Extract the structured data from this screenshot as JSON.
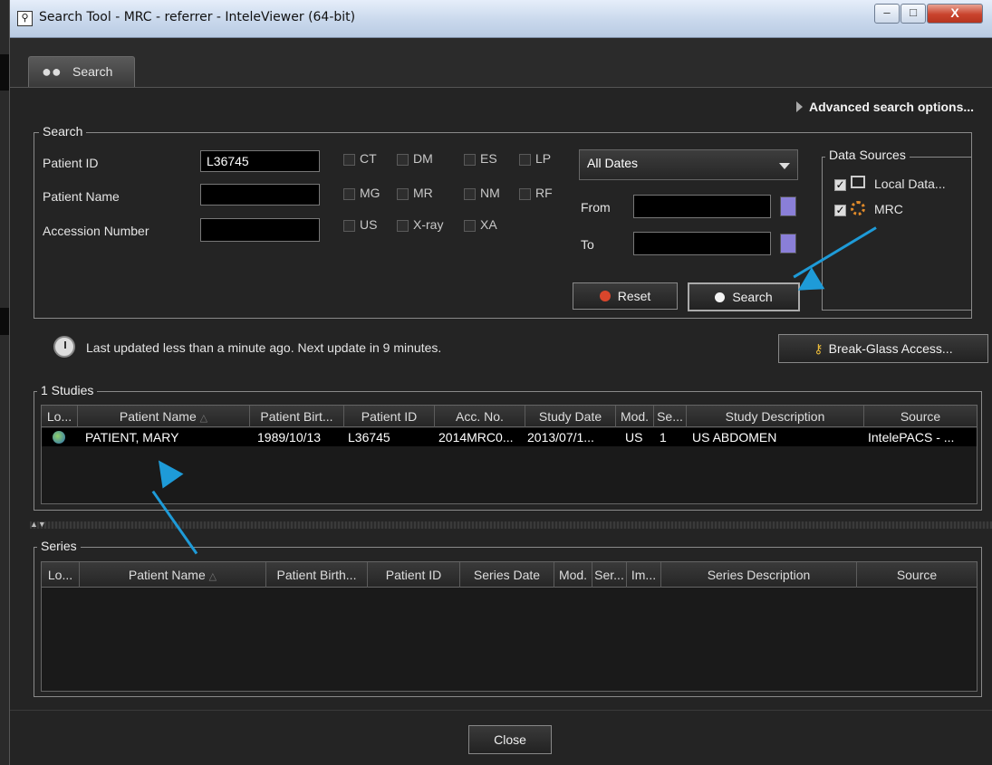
{
  "window": {
    "title": "Search Tool - MRC - referrer - InteleViewer (64-bit)",
    "min_label": "–",
    "max_label": "□",
    "close_label": "X"
  },
  "tab": {
    "label": "Search"
  },
  "advanced": {
    "label": "Advanced search options..."
  },
  "search": {
    "group_label": "Search",
    "patient_id_label": "Patient ID",
    "patient_id_value": "L36745",
    "patient_name_label": "Patient Name",
    "patient_name_value": "",
    "accession_label": "Accession Number",
    "accession_value": "",
    "modalities": [
      {
        "label": "CT",
        "checked": false
      },
      {
        "label": "DM",
        "checked": false
      },
      {
        "label": "ES",
        "checked": false
      },
      {
        "label": "LP",
        "checked": false
      },
      {
        "label": "MG",
        "checked": false
      },
      {
        "label": "MR",
        "checked": false
      },
      {
        "label": "NM",
        "checked": false
      },
      {
        "label": "RF",
        "checked": false
      },
      {
        "label": "US",
        "checked": false
      },
      {
        "label": "X-ray",
        "checked": false
      },
      {
        "label": "XA",
        "checked": false
      }
    ],
    "date_range": "All Dates",
    "from_label": "From",
    "to_label": "To",
    "from_value": "",
    "to_value": "",
    "reset_label": "Reset",
    "search_label": "Search"
  },
  "data_sources": {
    "label": "Data Sources",
    "items": [
      {
        "label": "Local Data...",
        "checked": true
      },
      {
        "label": "MRC",
        "checked": true
      }
    ]
  },
  "status": {
    "text": "Last updated less than a minute ago. Next update in 9 minutes.",
    "break_glass_label": "Break-Glass Access..."
  },
  "studies": {
    "group_label": "1 Studies",
    "columns": [
      "Lo...",
      "Patient Name",
      "Patient Birt...",
      "Patient ID",
      "Acc. No.",
      "Study Date",
      "Mod.",
      "Se...",
      "Study Description",
      "Source"
    ],
    "rows": [
      [
        "",
        "PATIENT, MARY",
        "1989/10/13",
        "L36745",
        "2014MRC0...",
        "2013/07/1...",
        "US",
        "1",
        "US ABDOMEN",
        "IntelePACS - ..."
      ]
    ]
  },
  "series": {
    "group_label": "Series",
    "columns": [
      "Lo...",
      "Patient Name",
      "Patient Birth...",
      "Patient ID",
      "Series Date",
      "Mod.",
      "Ser...",
      "Im...",
      "Series Description",
      "Source"
    ]
  },
  "footer": {
    "close_label": "Close"
  },
  "colors": {
    "annotation_arrow": "#1e9bd8",
    "selected_row": "#000000"
  },
  "icons": [
    "binoculars-icon",
    "clock-icon",
    "key-icon",
    "globe-icon",
    "computer-icon",
    "spinner-icon",
    "calendar-icon",
    "reset-icon"
  ]
}
